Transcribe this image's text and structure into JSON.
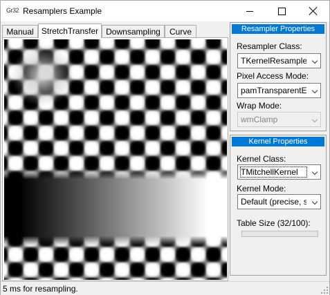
{
  "window": {
    "icon_text": "Gr32",
    "title": "Resamplers Example",
    "minimize": "minimize",
    "maximize": "maximize",
    "close": "close"
  },
  "tabs": [
    {
      "label": "Manual",
      "active": false
    },
    {
      "label": "StretchTransfer",
      "active": true
    },
    {
      "label": "Downsampling",
      "active": false
    },
    {
      "label": "Curve",
      "active": false
    }
  ],
  "resampler_panel": {
    "header": "Resampler Properties",
    "class_label": "Resampler Class:",
    "class_value": "TKernelResampler",
    "pixel_access_label": "Pixel Access Mode:",
    "pixel_access_value": "pamTransparentEdge",
    "wrap_label": "Wrap Mode:",
    "wrap_value": "wmClamp"
  },
  "kernel_panel": {
    "header": "Kernel Properties",
    "class_label": "Kernel Class:",
    "class_value": "TMitchellKernel",
    "mode_label": "Kernel Mode:",
    "mode_value": "Default (precise, slow)",
    "table_size_label": "Table Size (32/100):",
    "table_size_fraction": 0.0
  },
  "status": {
    "text": "5 ms for resampling."
  },
  "colors": {
    "accent": "#0078d7",
    "window_bg": "#f0f0f0"
  }
}
